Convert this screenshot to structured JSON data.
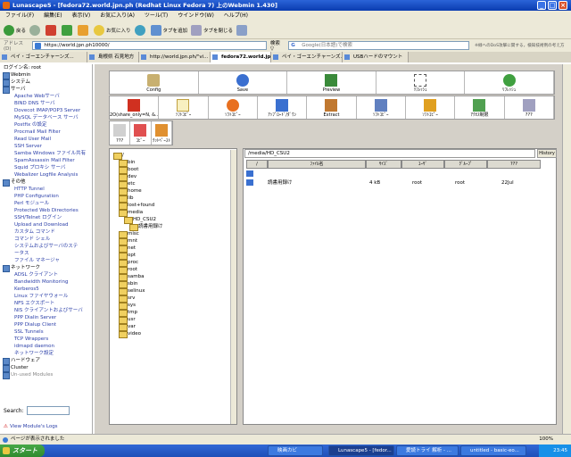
{
  "window": {
    "title": "Lunascape5 - [fedora72.world.jpn.ph (Redhat Linux Fedora 7) 上のWebmin 1.430]"
  },
  "menu": [
    "ファイル(F)",
    "編集(E)",
    "表示(V)",
    "お気に入り(A)",
    "ツール(T)",
    "ウインドウ(W)",
    "ヘルプ(H)"
  ],
  "toolbar": {
    "back": "戻る",
    "favorites": "お気に入り",
    "add_tab": "タブを追加",
    "close_tab": "タブを閉じる"
  },
  "address": {
    "label": "アドレス(D)",
    "url": "https://world.jpn.ph10000/",
    "search_label": "検索 ▽",
    "search_placeholder": "Google(日本語)で検索",
    "notice": "※緑へのDoS攻撃に関する，検知技術例の考え方"
  },
  "tabs": [
    {
      "label": "ペイ・ゴーエンチャーンズ..."
    },
    {
      "label": "島根県 石見地方"
    },
    {
      "label": "http://world.jpn.ph/\"vi..."
    },
    {
      "label": "fedora72.world.jpn..."
    },
    {
      "label": "ペイ・ゴーエンチャーンズ..."
    },
    {
      "label": "USBハードのマウント"
    }
  ],
  "sidebar": {
    "items": [
      {
        "kind": "head",
        "label": "ログイン名: root"
      },
      {
        "kind": "cat",
        "label": "Webmin"
      },
      {
        "kind": "cat",
        "label": "システム"
      },
      {
        "kind": "cat",
        "label": "サーバ"
      },
      {
        "kind": "mod",
        "label": "Apache Webサーバ"
      },
      {
        "kind": "mod",
        "label": "BIND DNS サーバ"
      },
      {
        "kind": "mod",
        "label": "Dovecot IMAP/POP3 Server"
      },
      {
        "kind": "mod",
        "label": "MySQL データベース サーバ"
      },
      {
        "kind": "mod",
        "label": "Postfix の設定"
      },
      {
        "kind": "mod",
        "label": "Procmail Mail Filter"
      },
      {
        "kind": "mod",
        "label": "Read User Mail"
      },
      {
        "kind": "mod",
        "label": "SSH Server"
      },
      {
        "kind": "mod",
        "label": "Samba Windows ファイル共有"
      },
      {
        "kind": "mod",
        "label": "SpamAssassin Mail Filter"
      },
      {
        "kind": "mod",
        "label": "Squid プロキシ サーバ"
      },
      {
        "kind": "mod",
        "label": "Webalizer Logfile Analysis"
      },
      {
        "kind": "cat",
        "label": "その他"
      },
      {
        "kind": "mod",
        "label": "HTTP Tunnel"
      },
      {
        "kind": "mod",
        "label": "PHP Configuration"
      },
      {
        "kind": "mod",
        "label": "Perl モジュール"
      },
      {
        "kind": "mod",
        "label": "Protected Web Directories"
      },
      {
        "kind": "mod",
        "label": "SSH/Telnet ログイン"
      },
      {
        "kind": "mod",
        "label": "Upload and Download"
      },
      {
        "kind": "mod",
        "label": "カスタム コマンド"
      },
      {
        "kind": "mod",
        "label": "コマンド シェル"
      },
      {
        "kind": "mod",
        "label": "システムおよびサーバのステ"
      },
      {
        "kind": "mod",
        "label": "ータス"
      },
      {
        "kind": "mod",
        "label": "ファイル マネージャ"
      },
      {
        "kind": "cat",
        "label": "ネットワーク"
      },
      {
        "kind": "mod",
        "label": "ADSL クライアント"
      },
      {
        "kind": "mod",
        "label": "Bandwidth Monitoring"
      },
      {
        "kind": "mod",
        "label": "Kerberos5"
      },
      {
        "kind": "mod",
        "label": "Linux ファイヤウォール"
      },
      {
        "kind": "mod",
        "label": "NFS エクスポート"
      },
      {
        "kind": "mod",
        "label": "NIS クライアントおよびサーバ"
      },
      {
        "kind": "mod",
        "label": "PPP Dialin Server"
      },
      {
        "kind": "mod",
        "label": "PPP Dialup Client"
      },
      {
        "kind": "mod",
        "label": "SSL Tunnels"
      },
      {
        "kind": "mod",
        "label": "TCP Wrappers"
      },
      {
        "kind": "mod",
        "label": "idmapd daemon"
      },
      {
        "kind": "mod",
        "label": "ネットワーク設定"
      },
      {
        "kind": "cat",
        "label": "ハードウェア"
      },
      {
        "kind": "cat",
        "label": "Cluster"
      },
      {
        "kind": "cat",
        "label": "Un-used Modules",
        "grey": true
      }
    ],
    "search_label": "Search:",
    "view_modules": "View Module's Logs"
  },
  "fm_toolbar1": [
    "Config",
    "Save",
    "Preview",
    "ﾘﾌﾚｯｼｭ",
    "ﾘﾌﾚｯｼｭ"
  ],
  "fm_toolbar2": [
    "2O(share_only=N, &...",
    "ｿﾌﾄｺﾋﾟｰ",
    "ｿﾌﾄｺﾋﾟｰ",
    "ｱｯﾌﾟﾛｰﾄﾞ/ﾀﾞｳﾝ",
    "Extract",
    "ｿﾌﾄｺﾋﾟｰ",
    "ｿﾌﾄｺﾋﾟｰ",
    "ｱｸｾｽ制限",
    "???"
  ],
  "fm_toolbar3": [
    "???",
    "ｺﾋﾟｰ",
    "ｸｯﾄﾍﾟｰｽﾄ"
  ],
  "tree": [
    {
      "label": "/",
      "depth": 0
    },
    {
      "label": "bin",
      "depth": 1
    },
    {
      "label": "boot",
      "depth": 1
    },
    {
      "label": "dev",
      "depth": 1
    },
    {
      "label": "etc",
      "depth": 1
    },
    {
      "label": "home",
      "depth": 1
    },
    {
      "label": "lib",
      "depth": 1
    },
    {
      "label": "lost+found",
      "depth": 1
    },
    {
      "label": "media",
      "depth": 1
    },
    {
      "label": "HD_CSU2",
      "depth": 2
    },
    {
      "label": "読書用録け",
      "depth": 3
    },
    {
      "label": "misc",
      "depth": 1
    },
    {
      "label": "mnt",
      "depth": 1
    },
    {
      "label": "net",
      "depth": 1
    },
    {
      "label": "opt",
      "depth": 1
    },
    {
      "label": "proc",
      "depth": 1
    },
    {
      "label": "root",
      "depth": 1
    },
    {
      "label": "samba",
      "depth": 1
    },
    {
      "label": "sbin",
      "depth": 1
    },
    {
      "label": "selinux",
      "depth": 1
    },
    {
      "label": "srv",
      "depth": 1
    },
    {
      "label": "sys",
      "depth": 1
    },
    {
      "label": "tmp",
      "depth": 1
    },
    {
      "label": "usr",
      "depth": 1
    },
    {
      "label": "var",
      "depth": 1
    },
    {
      "label": "video",
      "depth": 1
    }
  ],
  "files": {
    "path": "/media/HD_CSU2",
    "history_label": "History",
    "columns": [
      "/",
      "ﾌｧｲﾙ名",
      "ｻｲｽﾞ",
      "ﾕｰｻﾞ",
      "ｸﾞﾙｰﾌﾟ",
      "???"
    ],
    "rows": [
      {
        "name": "",
        "size": "",
        "user": "",
        "group": "",
        "date": ""
      },
      {
        "name": "読書用録け",
        "size": "4 kB",
        "user": "root",
        "group": "root",
        "date": "22Jul"
      }
    ]
  },
  "status": {
    "text": "ページが表示されました",
    "zoom": "100%"
  },
  "taskbar": {
    "start": "スタート",
    "tasks": [
      "映画カビ",
      "Lunascape5 - [fedor...",
      "愛読トライ 解析 - ...",
      "untitled - basic-eo..."
    ],
    "clock": "23:45"
  }
}
